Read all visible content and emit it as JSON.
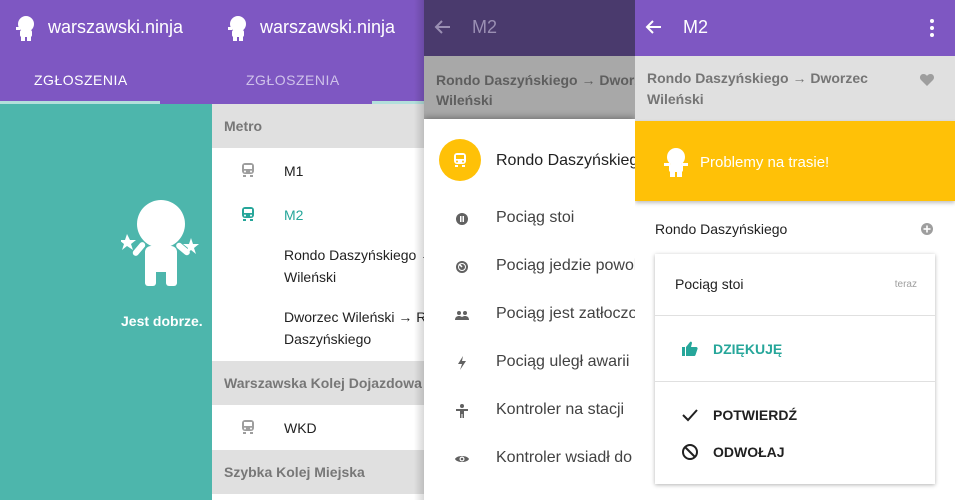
{
  "app": {
    "title": "warszawski.ninja"
  },
  "colors": {
    "primary": "#7e57c2",
    "accent_teal": "#26a69a",
    "yellow": "#ffc107",
    "background_teal": "#4db6ac"
  },
  "screen1": {
    "tab_label": "ZGŁOSZENIA",
    "status_message": "Jest dobrze."
  },
  "screen2": {
    "tab_label": "ZGŁOSZENIA",
    "sections": [
      {
        "title": "Metro"
      },
      {
        "title": "Warszawska Kolej Dojazdowa"
      },
      {
        "title": "Szybka Kolej Miejska"
      }
    ],
    "items": [
      {
        "label": "M1",
        "icon": "subway-icon"
      },
      {
        "label": "M2",
        "icon": "subway-icon"
      },
      {
        "label_line1": "Rondo Daszyńskiego →",
        "label_line2": "Wileński"
      },
      {
        "label_line1": "Dworzec Wileński → Ro",
        "label_line2": "Daszyńskiego"
      },
      {
        "label": "WKD",
        "icon": "train-icon"
      }
    ]
  },
  "screen3": {
    "title": "M2",
    "route_line1": "Rondo Daszyńskiego → Dworzec",
    "route_line2": "Wileński",
    "station": "Rondo Daszyńskiego",
    "options": [
      {
        "label": "Pociąg stoi",
        "icon": "pause-icon"
      },
      {
        "label": "Pociąg jedzie powol",
        "icon": "slow-icon"
      },
      {
        "label": "Pociąg jest zatłoczo",
        "icon": "people-icon"
      },
      {
        "label": "Pociąg uległ awarii",
        "icon": "lightning-icon"
      },
      {
        "label": "Kontroler na stacji",
        "icon": "person-icon"
      },
      {
        "label": "Kontroler wsiadł do",
        "icon": "eye-icon"
      }
    ]
  },
  "screen4": {
    "title": "M2",
    "route_line1": "Rondo Daszyńskiego → Dworzec",
    "route_line2": "Wileński",
    "banner_text": "Problemy na trasie!",
    "station": "Rondo Daszyńskiego",
    "report_text": "Pociąg stoi",
    "report_time": "teraz",
    "thanks_label": "DZIĘKUJĘ",
    "confirm_label": "POTWIERDŹ",
    "cancel_label": "ODWOŁAJ"
  }
}
